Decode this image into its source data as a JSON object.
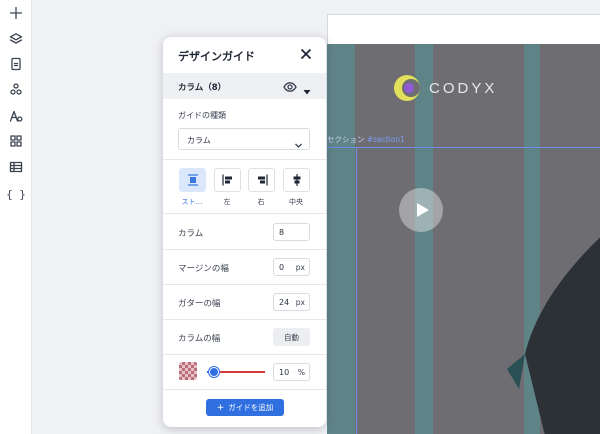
{
  "toolbar": {
    "items": [
      {
        "name": "add",
        "icon": "plus-icon"
      },
      {
        "name": "layers",
        "icon": "layers-icon"
      },
      {
        "name": "pages",
        "icon": "page-icon"
      },
      {
        "name": "components",
        "icon": "components-icon"
      },
      {
        "name": "typography",
        "icon": "font-icon"
      },
      {
        "name": "apps",
        "icon": "grid-icon"
      },
      {
        "name": "table",
        "icon": "table-icon"
      },
      {
        "name": "code",
        "icon": "code-braces-icon",
        "glyph": "{ }"
      }
    ]
  },
  "canvas": {
    "logo_text": "CODYX",
    "section_label": "セクション",
    "section_id": "#section1",
    "colors": {
      "background": "#6d6d72",
      "guide_column": "#4aaaaa",
      "selection": "#6f8fe6",
      "logo_ring": "#e2e05a",
      "logo_dot": "#8f5bd6"
    }
  },
  "panel": {
    "title": "デザインガイド",
    "section_title": "カラム（8）",
    "guide_type_label": "ガイドの種類",
    "guide_type_value": "カラム",
    "alignment": {
      "options": [
        {
          "label": "スト…",
          "icon": "stretch-align-icon",
          "active": true
        },
        {
          "label": "左",
          "icon": "left-align-icon",
          "active": false
        },
        {
          "label": "右",
          "icon": "right-align-icon",
          "active": false
        },
        {
          "label": "中央",
          "icon": "center-align-icon",
          "active": false
        }
      ]
    },
    "columns": {
      "label": "カラム",
      "value": "8"
    },
    "margin": {
      "label": "マージンの幅",
      "value": "0",
      "unit": "px"
    },
    "gutter": {
      "label": "ガターの幅",
      "value": "24",
      "unit": "px"
    },
    "column_width": {
      "label": "カラムの幅",
      "value": "自動"
    },
    "opacity": {
      "value": "10",
      "unit": "%",
      "fraction": 0.1
    },
    "add_button": "ガイドを追加",
    "colors": {
      "accent": "#2f6fe0",
      "guide_color": "#d73a3a"
    }
  }
}
